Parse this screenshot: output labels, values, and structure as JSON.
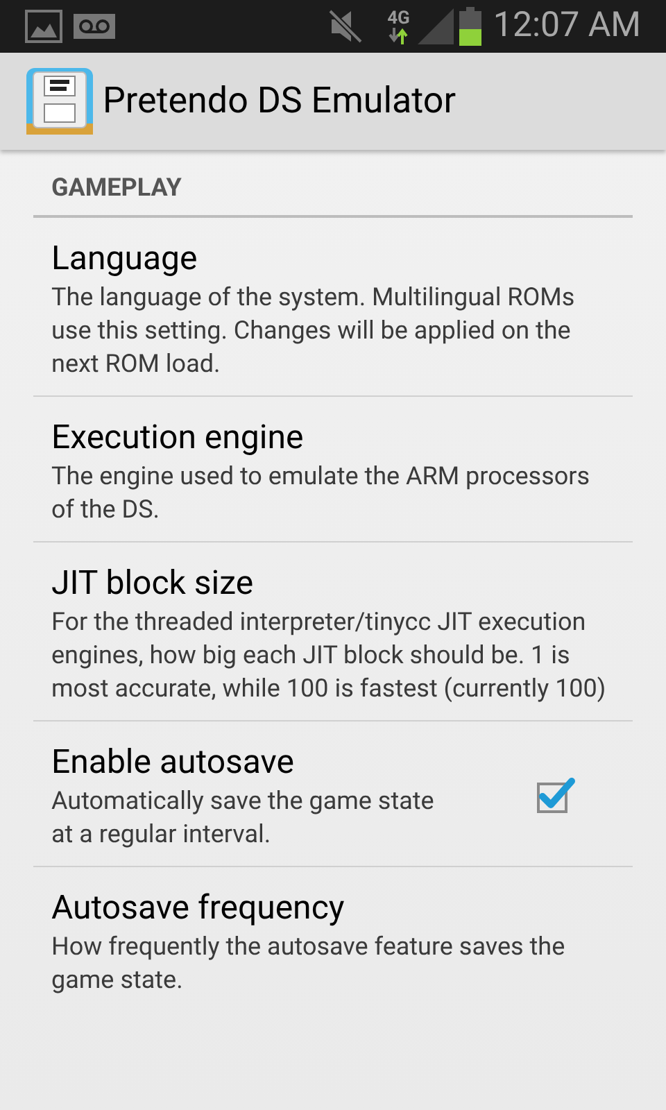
{
  "status_bar": {
    "network": "4G",
    "time": "12:07 AM"
  },
  "action_bar": {
    "title": "Pretendo DS Emulator"
  },
  "category": "GAMEPLAY",
  "preferences": [
    {
      "kind": "plain",
      "title": "Language",
      "summary": "The language of the system. Multilingual ROMs use this setting. Changes will be applied on the next ROM load."
    },
    {
      "kind": "plain",
      "title": "Execution engine",
      "summary": "The engine used to emulate the ARM processors of the DS."
    },
    {
      "kind": "plain",
      "title": "JIT block size",
      "summary": "For the threaded interpreter/tinycc JIT execution engines, how big each JIT block should be. 1 is most accurate, while 100 is fastest (currently 100)"
    },
    {
      "kind": "checkbox",
      "title": "Enable autosave",
      "summary": "Automatically save the game state at a regular interval.",
      "checked": true
    },
    {
      "kind": "plain",
      "title": "Autosave frequency",
      "summary": "How frequently the autosave feature saves the game state."
    }
  ]
}
